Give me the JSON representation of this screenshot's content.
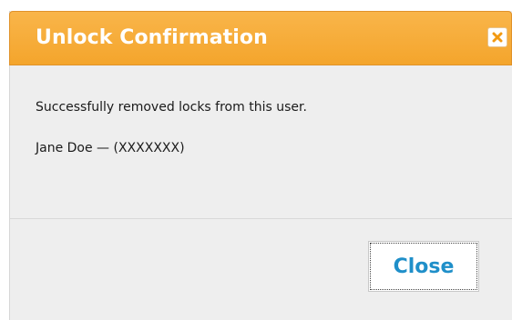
{
  "dialog": {
    "title": "Unlock Confirmation",
    "close_icon": "close-x-icon",
    "message": "Successfully removed locks from this user.",
    "user_line": "Jane Doe — (XXXXXXX)",
    "close_button_label": "Close"
  },
  "colors": {
    "titlebar": "#f4a52c",
    "close_icon": "#f29a12",
    "button_text": "#1f8fc9",
    "panel_bg": "#eeeeee"
  }
}
